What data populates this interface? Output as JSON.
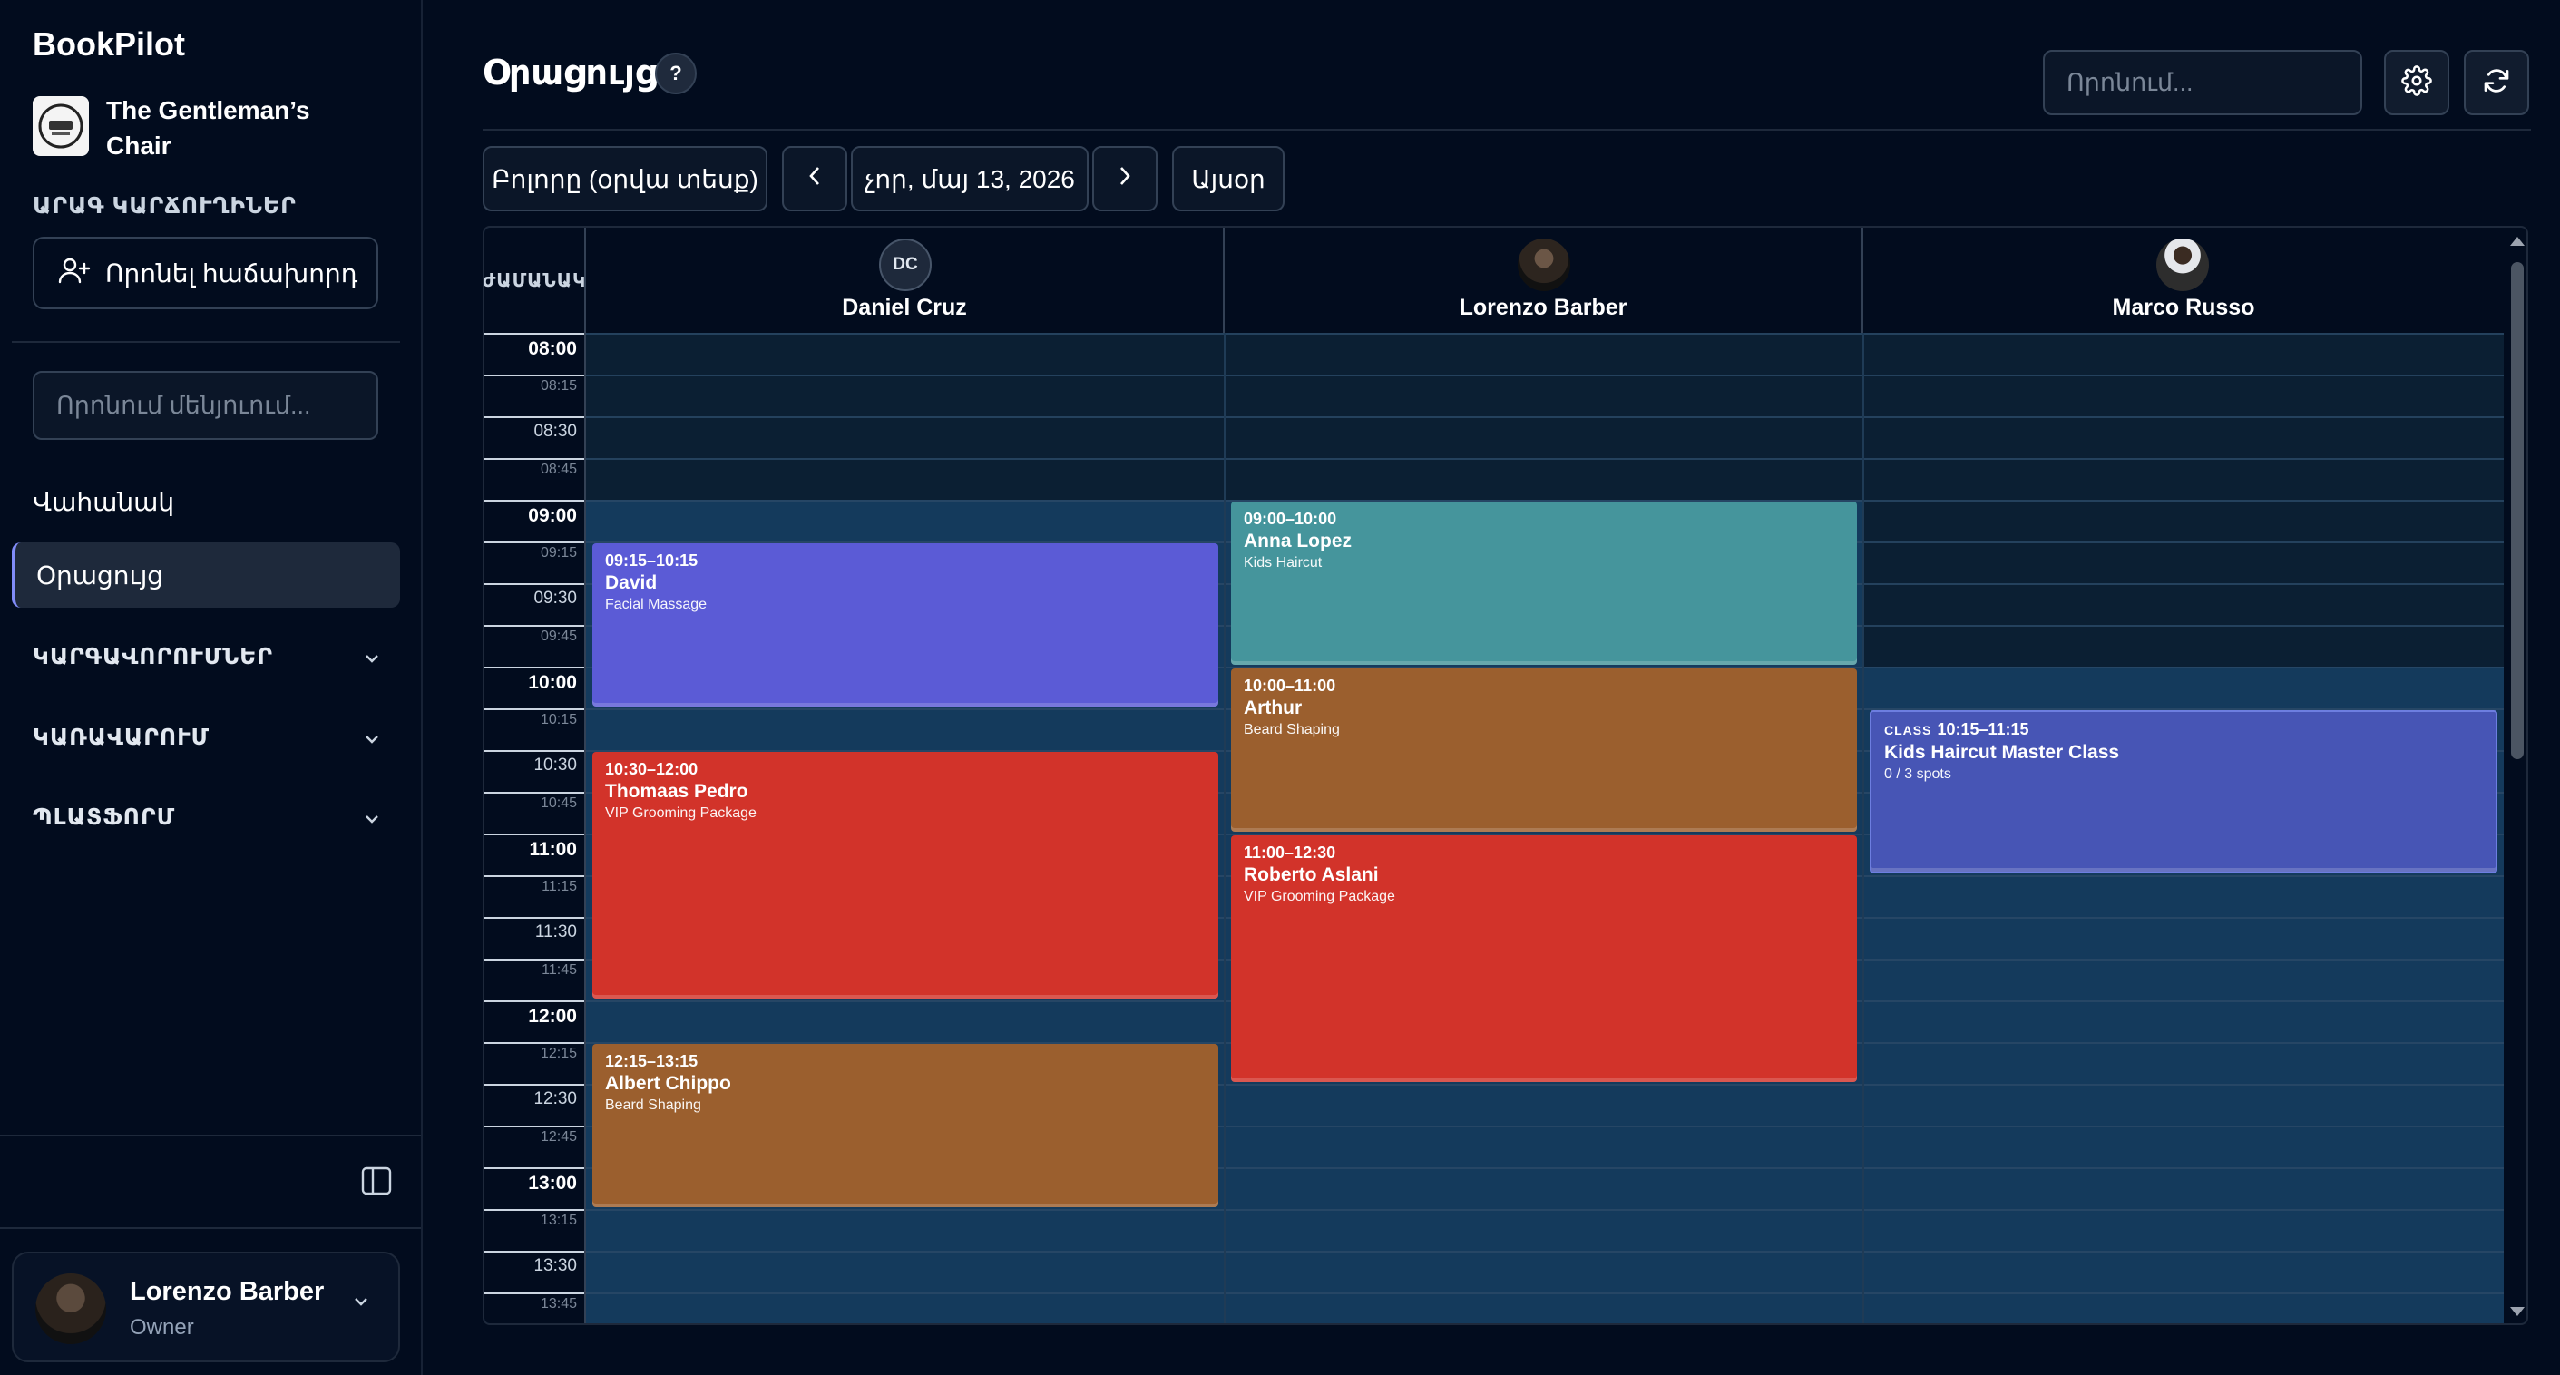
{
  "app": {
    "brand": "BookPilot",
    "business_name": "The Gentleman’s Chair"
  },
  "sidebar": {
    "quick_actions_label": "ԱՐԱԳ ԿԱՐՃՈՒՂԻՆԵՐ",
    "find_client_label": "Որոնել հաճախորդ",
    "menu_search_placeholder": "Որոնում մենյուում...",
    "nav": [
      {
        "label": "Վահանակ",
        "active": false
      },
      {
        "label": "Օրացույց",
        "active": true
      }
    ],
    "groups": [
      {
        "label": "ԿԱՐԳԱՎՈՐՈՒՄՆԵՐ"
      },
      {
        "label": "ԿԱՌԱՎԱՐՈՒՄ"
      },
      {
        "label": "ՊԼԱՏՖՈՐՄ"
      }
    ],
    "user": {
      "name": "Lorenzo Barber",
      "role": "Owner"
    }
  },
  "header": {
    "title": "Օրացույց",
    "help": "?",
    "search_placeholder": "Որոնում..."
  },
  "toolbar": {
    "view_label": "Բոլորը (օրվա տեսք)",
    "date_label": "չոր, մայ 13, 2026",
    "today_label": "Այսօր"
  },
  "calendar": {
    "time_header": "ԺԱՄԱՆԱԿ",
    "staff": [
      {
        "name": "Daniel Cruz",
        "initials": "DC"
      },
      {
        "name": "Lorenzo Barber",
        "initials": ""
      },
      {
        "name": "Marco Russo",
        "initials": ""
      }
    ],
    "times": [
      "08:00",
      "08:15",
      "08:30",
      "08:45",
      "09:00",
      "09:15",
      "09:30",
      "09:45",
      "10:00",
      "10:15",
      "10:30",
      "10:45",
      "11:00",
      "11:15",
      "11:30",
      "11:45",
      "12:00",
      "12:15",
      "12:30",
      "12:45",
      "13:00",
      "13:15",
      "13:30",
      "13:45"
    ],
    "appointments": [
      {
        "staff": 0,
        "time": "09:15–10:15",
        "client": "David",
        "service": "Facial Massage",
        "color": "#5b5bd6"
      },
      {
        "staff": 0,
        "time": "10:30–12:00",
        "client": "Thomaas Pedro",
        "service": "VIP Grooming Package",
        "color": "#d2332a"
      },
      {
        "staff": 0,
        "time": "12:15–13:15",
        "client": "Albert Chippo",
        "service": "Beard Shaping",
        "color": "#9b5f2e"
      },
      {
        "staff": 1,
        "time": "09:00–10:00",
        "client": "Anna Lopez",
        "service": "Kids Haircut",
        "color": "#45959c"
      },
      {
        "staff": 1,
        "time": "10:00–11:00",
        "client": "Arthur",
        "service": "Beard Shaping",
        "color": "#9b5f2e"
      },
      {
        "staff": 1,
        "time": "11:00–12:30",
        "client": "Roberto Aslani",
        "service": "VIP Grooming Package",
        "color": "#d2332a"
      },
      {
        "staff": 2,
        "time": "10:15–11:15",
        "client": "Kids Haircut Master Class",
        "service": "0 / 3 spots",
        "color": "#4755b5",
        "badge": "CLASS"
      }
    ]
  }
}
